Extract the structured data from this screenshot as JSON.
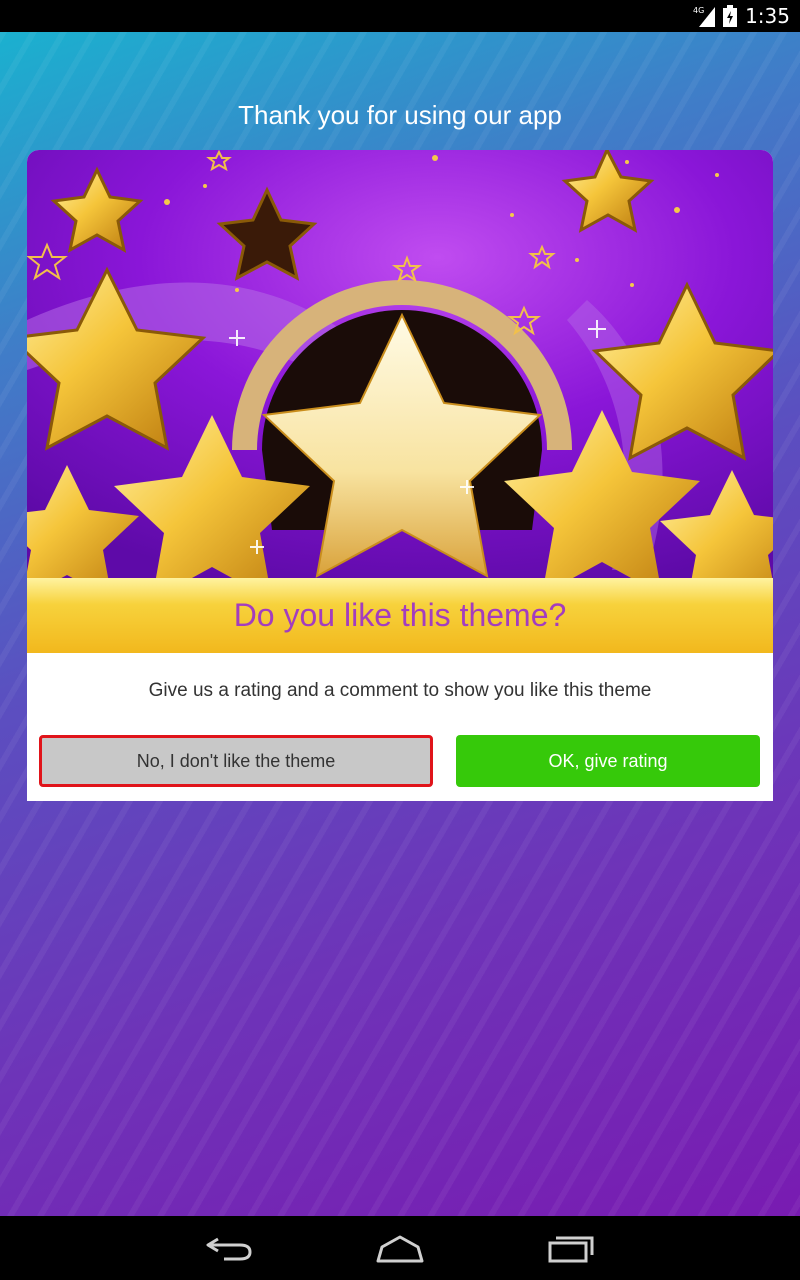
{
  "status_bar": {
    "network": "4G",
    "time": "1:35"
  },
  "headline": "Thank you for using our app",
  "dialog": {
    "banner_question": "Do you like this theme?",
    "message": "Give us a rating and a comment to show you like this theme",
    "no_button_label": "No, I don't like the theme",
    "ok_button_label": "OK, give rating"
  },
  "nav_bar": {
    "icons": [
      "back-icon",
      "home-icon",
      "recent-apps-icon"
    ]
  },
  "colors": {
    "question_text": "#a33dbf",
    "ok_button": "#36c90a",
    "no_button": "#c8c8c8",
    "highlight_border": "#e0141a"
  }
}
